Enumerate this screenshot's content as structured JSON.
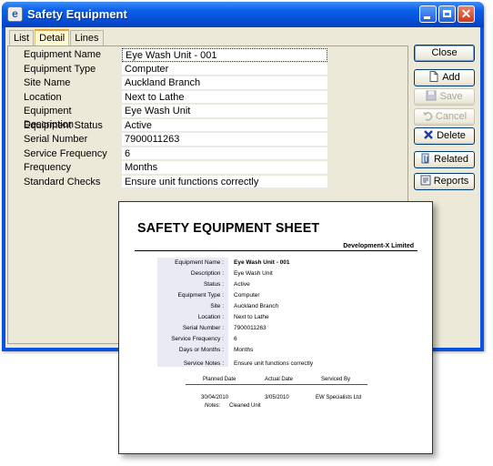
{
  "window": {
    "title": "Safety Equipment"
  },
  "tabs": [
    {
      "label": "List"
    },
    {
      "label": "Detail"
    },
    {
      "label": "Lines"
    }
  ],
  "fields": [
    {
      "label": "Equipment Name",
      "value": "Eye Wash Unit - 001"
    },
    {
      "label": "Equipment Type",
      "value": "Computer"
    },
    {
      "label": "Site Name",
      "value": "Auckland Branch"
    },
    {
      "label": "Location",
      "value": "Next to Lathe"
    },
    {
      "label": "Equipment Description",
      "value": "Eye Wash Unit"
    },
    {
      "label": "Equipment Status",
      "value": "Active"
    },
    {
      "label": "Serial Number",
      "value": "7900011263"
    },
    {
      "label": "Service Frequency",
      "value": "6"
    },
    {
      "label": "Frequency",
      "value": "Months"
    },
    {
      "label": "Standard Checks",
      "value": "Ensure unit functions correctly"
    }
  ],
  "buttons": {
    "close": "Close",
    "add": "Add",
    "save": "Save",
    "cancel": "Cancel",
    "delete": "Delete",
    "related": "Related",
    "reports": "Reports"
  },
  "report": {
    "title": "SAFETY EQUIPMENT SHEET",
    "company": "Development-X Limited",
    "rows": [
      {
        "k": "Equipment Name :",
        "v": "Eye Wash Unit - 001"
      },
      {
        "k": "Description :",
        "v": "Eye Wash Unit"
      },
      {
        "k": "Status :",
        "v": "Active"
      },
      {
        "k": "Equipment Type :",
        "v": "Computer"
      },
      {
        "k": "Site :",
        "v": "Auckland Branch"
      },
      {
        "k": "Location :",
        "v": "Next to Lathe"
      },
      {
        "k": "Serial Number :",
        "v": "7900011263"
      },
      {
        "k": "Service Frequency :",
        "v": "6"
      },
      {
        "k": "Days or Months :",
        "v": "Months"
      },
      {
        "k": "Service Notes :",
        "v": "Ensure unit functions correctly"
      }
    ],
    "table_headers": {
      "planned": "Planned Date",
      "actual": "Actual Date",
      "serviced": "Serviced By"
    },
    "table_row": {
      "planned": "30/04/2010",
      "actual": "3/05/2010",
      "serviced": "EW Specialists Ltd"
    },
    "notes_label": "Notes:",
    "notes_value": "Cleaned Unit"
  },
  "icons": {
    "app": "app-logo-icon",
    "add": "new-document-icon",
    "save": "floppy-disk-icon",
    "cancel": "undo-icon",
    "delete": "x-icon",
    "related": "paperclip-icon",
    "reports": "report-icon"
  },
  "colors": {
    "titlebar": "#0a5ee8",
    "client_bg": "#ece9d8",
    "delete_icon": "#1a3fa0"
  }
}
